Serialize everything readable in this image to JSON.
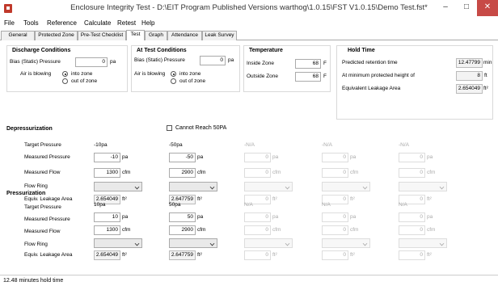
{
  "window": {
    "title": "Enclosure Integrity Test - D:\\EIT Program Published Versions warthog\\1.0.15\\FST V1.0.15\\Demo Test.fst*",
    "minimize": "–",
    "maximize": "□",
    "close": "✕"
  },
  "menu": [
    "File",
    "Tools",
    "Reference",
    "Calculate",
    "Retest",
    "Help"
  ],
  "tabs": [
    "General",
    "Protected Zone",
    "Pre-Test Checklist",
    "Test",
    "Graph",
    "Attendance",
    "Leak Survey"
  ],
  "active_tab": "Test",
  "discharge": {
    "title": "Discharge Conditions",
    "bias_label": "Bias (Static) Pressure",
    "bias_value": "0",
    "bias_unit": "pa",
    "air_label": "Air is blowing",
    "into_zone": "into zone",
    "out_of_zone": "out of zone"
  },
  "at_test": {
    "title": "At Test Conditions",
    "bias_label": "Bias (Static) Pressure",
    "bias_value": "0",
    "bias_unit": "pa",
    "air_label": "Air is blowing",
    "into_zone": "into zone",
    "out_of_zone": "out of zone"
  },
  "temperature": {
    "title": "Temperature",
    "inside_label": "Inside Zone",
    "inside_value": "68",
    "outside_label": "Outside Zone",
    "outside_value": "68",
    "unit": "F"
  },
  "hold_time": {
    "title": "Hold Time",
    "retention_label": "Predicted retention time",
    "retention_value": "12.47799",
    "retention_unit": "min",
    "min_height_label": "At minimum protected height of",
    "min_height_value": "8",
    "min_height_unit": "ft",
    "ela_label": "Equivalent Leakage Area",
    "ela_value": "2.654049",
    "ela_unit": "ft²"
  },
  "depressurization": {
    "title": "Depressurization",
    "cannot_reach": "Cannot Reach 50PA",
    "row_labels": [
      "Target Pressure",
      "Measured Pressure",
      "Measured Flow",
      "Flow Ring",
      "Equiv. Leakage Area"
    ],
    "columns": [
      {
        "target": "-10pa",
        "pressure": "-10",
        "flow": "1300",
        "ela": "2.654049",
        "enabled": true
      },
      {
        "target": "-50pa",
        "pressure": "-50",
        "flow": "2900",
        "ela": "2.647759",
        "enabled": true
      },
      {
        "target": "-N/A",
        "pressure": "0",
        "flow": "0",
        "ela": "0",
        "enabled": false
      },
      {
        "target": "-N/A",
        "pressure": "0",
        "flow": "0",
        "ela": "0",
        "enabled": false
      },
      {
        "target": "-N/A",
        "pressure": "0",
        "flow": "0",
        "ela": "0",
        "enabled": false
      }
    ]
  },
  "pressurization": {
    "title": "Pressurization",
    "row_labels": [
      "Target Pressure",
      "Measured Pressure",
      "Measured Flow",
      "Flow Ring",
      "Equiv. Leakage Area"
    ],
    "columns": [
      {
        "target": "10pa",
        "pressure": "10",
        "flow": "1300",
        "ela": "2.654049",
        "enabled": true
      },
      {
        "target": "50pa",
        "pressure": "50",
        "flow": "2900",
        "ela": "2.647759",
        "enabled": true
      },
      {
        "target": "N/A",
        "pressure": "0",
        "flow": "0",
        "ela": "0",
        "enabled": false
      },
      {
        "target": "N/A",
        "pressure": "0",
        "flow": "0",
        "ela": "0",
        "enabled": false
      },
      {
        "target": "N/A",
        "pressure": "0",
        "flow": "0",
        "ela": "0",
        "enabled": false
      }
    ]
  },
  "units": {
    "pa": "pa",
    "cfm": "cfm",
    "ft2": "ft²"
  },
  "status": "12.48 minutes hold time",
  "colors": {
    "close_button": "#c74a46",
    "app_icon": "#c0392b"
  }
}
